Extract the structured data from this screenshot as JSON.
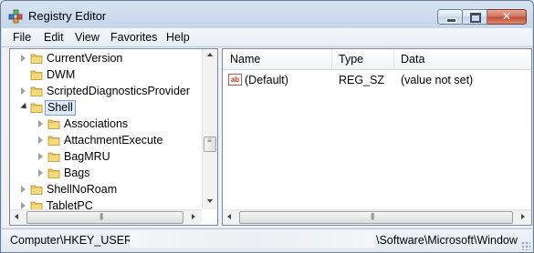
{
  "window": {
    "title": "Registry Editor",
    "close_glyph": "✕"
  },
  "menu": [
    "File",
    "Edit",
    "View",
    "Favorites",
    "Help"
  ],
  "tree": {
    "nodes": [
      {
        "label": "CurrentVersion",
        "expander": "closed"
      },
      {
        "label": "DWM",
        "expander": "none"
      },
      {
        "label": "ScriptedDiagnosticsProvider",
        "expander": "closed"
      },
      {
        "label": "Shell",
        "expander": "open",
        "selected": true
      },
      {
        "label": "Associations",
        "expander": "closed"
      },
      {
        "label": "AttachmentExecute",
        "expander": "closed"
      },
      {
        "label": "BagMRU",
        "expander": "closed"
      },
      {
        "label": "Bags",
        "expander": "closed"
      },
      {
        "label": "ShellNoRoam",
        "expander": "closed"
      },
      {
        "label": "TabletPC",
        "expander": "closed"
      }
    ]
  },
  "list": {
    "columns": [
      "Name",
      "Type",
      "Data"
    ],
    "rows": [
      {
        "name": "(Default)",
        "type": "REG_SZ",
        "data": "(value not set)",
        "icon": "string-value-icon"
      }
    ],
    "icon_text": "ab"
  },
  "status": {
    "path_start": "Computer\\HKEY_USERS\\",
    "path_end": "\\Software\\Microsoft\\Window"
  },
  "colors": {
    "selection_bg": "#dcebfc",
    "selection_border": "#7da2ce",
    "folder": "#e8c25a",
    "close_button": "#c24a2f"
  }
}
